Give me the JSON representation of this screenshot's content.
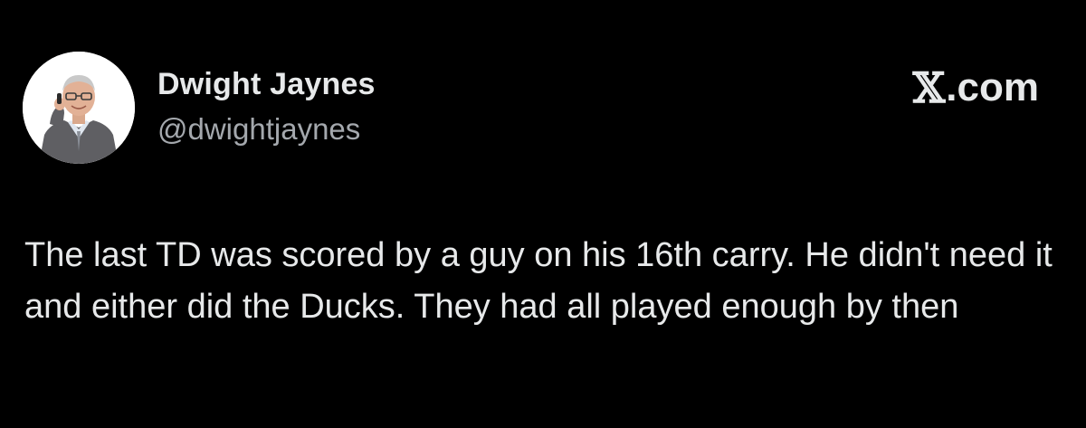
{
  "author": {
    "name": "Dwight Jaynes",
    "handle": "@dwightjaynes",
    "avatar_icon": "person-portrait-avatar"
  },
  "brand": {
    "glyph": "𝕏",
    "suffix": ".com",
    "icon": "x-logo-icon"
  },
  "tweet": {
    "text": "The last TD was scored by a guy on his 16th carry. He didn't need it and either did the Ducks. They had all played enough by then"
  },
  "colors": {
    "background": "#000000",
    "text": "#e7e9ea",
    "secondary_text": "#a4a8ad"
  }
}
